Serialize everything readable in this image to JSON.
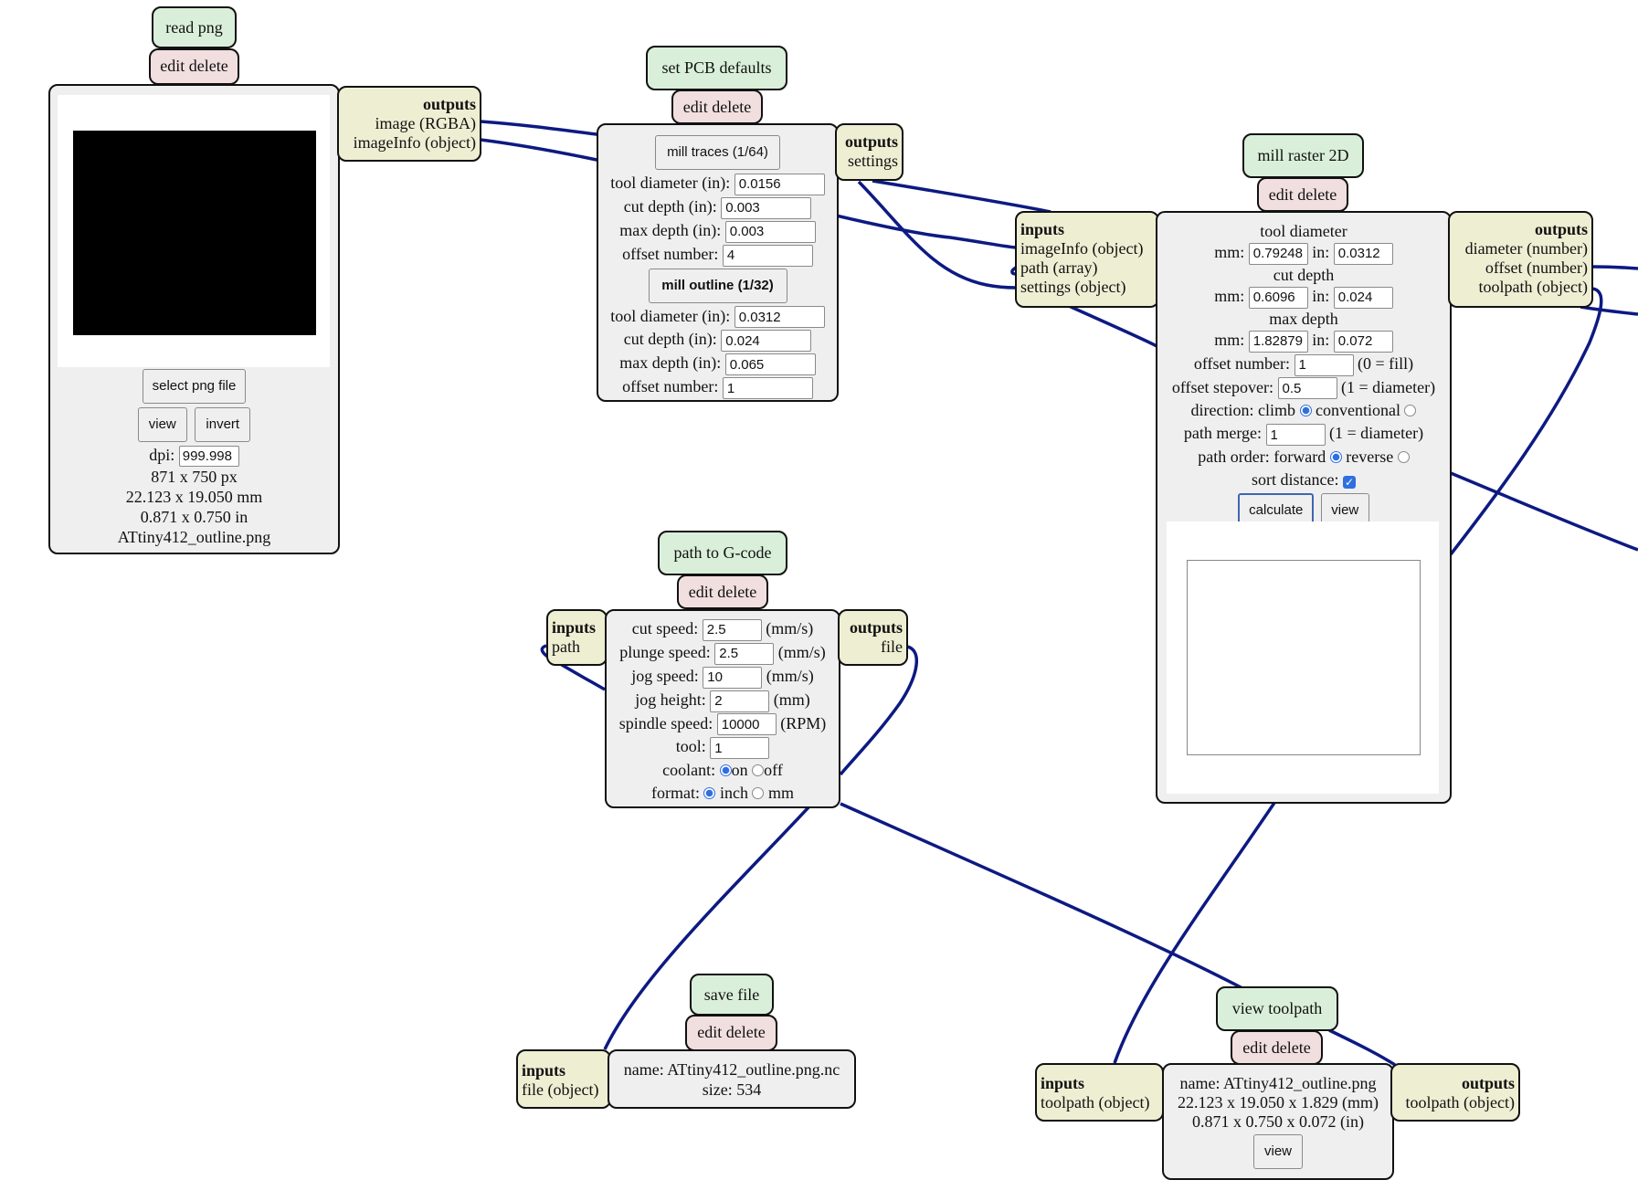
{
  "colors": {
    "wire": "#0d1a82",
    "title_bg": "#d9efd9",
    "edit_bg": "#f1dede",
    "io_bg": "#eeeed3",
    "body_bg": "#efefef",
    "radio_checked": "#2f6fe0"
  },
  "common": {
    "edit": "edit",
    "delete": "delete",
    "inputs": "inputs",
    "outputs": "outputs"
  },
  "modules": {
    "read_png": {
      "title": "read png",
      "outputs": [
        "image (RGBA)",
        "imageInfo (object)"
      ],
      "buttons": {
        "select": "select png file",
        "view": "view",
        "invert": "invert"
      },
      "dpi_label": "dpi:",
      "dpi_value": "999.998",
      "size_px": "871 x 750 px",
      "size_mm": "22.123 x 19.050 mm",
      "size_in": "0.871 x 0.750 in",
      "filename": "ATtiny412_outline.png"
    },
    "set_pcb_defaults": {
      "title": "set PCB defaults",
      "outputs": [
        "settings"
      ],
      "traces": {
        "button": "mill traces (1/64)",
        "tool_diameter_label": "tool diameter (in):",
        "tool_diameter": "0.0156",
        "cut_depth_label": "cut depth (in):",
        "cut_depth": "0.003",
        "max_depth_label": "max depth (in):",
        "max_depth": "0.003",
        "offset_number_label": "offset number:",
        "offset_number": "4"
      },
      "outline": {
        "button": "mill outline (1/32)",
        "tool_diameter_label": "tool diameter (in):",
        "tool_diameter": "0.0312",
        "cut_depth_label": "cut depth (in):",
        "cut_depth": "0.024",
        "max_depth_label": "max depth (in):",
        "max_depth": "0.065",
        "offset_number_label": "offset number:",
        "offset_number": "1"
      }
    },
    "mill_raster_2d": {
      "title": "mill raster 2D",
      "inputs": [
        "imageInfo (object)",
        "path (array)",
        "settings (object)"
      ],
      "outputs": [
        "diameter (number)",
        "offset (number)",
        "toolpath (object)"
      ],
      "tool_diameter_label": "tool diameter",
      "tool_diameter_mm": "0.79248",
      "tool_diameter_in": "0.0312",
      "cut_depth_label": "cut depth",
      "cut_depth_mm": "0.6096",
      "cut_depth_in": "0.024",
      "max_depth_label": "max depth",
      "max_depth_mm": "1.82879",
      "max_depth_in": "0.072",
      "mm_label": "mm:",
      "in_label": "in:",
      "offset_number_label": "offset number:",
      "offset_number": "1",
      "offset_number_hint": "(0 = fill)",
      "offset_stepover_label": "offset stepover:",
      "offset_stepover": "0.5",
      "offset_stepover_hint": "(1 = diameter)",
      "direction_label": "direction:",
      "direction_climb": "climb",
      "direction_conventional": "conventional",
      "direction_selected": "climb",
      "path_merge_label": "path merge:",
      "path_merge": "1",
      "path_merge_hint": "(1 = diameter)",
      "path_order_label": "path order:",
      "path_order_forward": "forward",
      "path_order_reverse": "reverse",
      "path_order_selected": "forward",
      "sort_distance_label": "sort distance:",
      "sort_distance": true,
      "calculate": "calculate",
      "view": "view"
    },
    "path_to_gcode": {
      "title": "path to G-code",
      "inputs": [
        "path"
      ],
      "outputs": [
        "file"
      ],
      "cut_speed_label": "cut speed:",
      "cut_speed": "2.5",
      "cut_speed_unit": "(mm/s)",
      "plunge_speed_label": "plunge speed:",
      "plunge_speed": "2.5",
      "plunge_speed_unit": "(mm/s)",
      "jog_speed_label": "jog speed:",
      "jog_speed": "10",
      "jog_speed_unit": "(mm/s)",
      "jog_height_label": "jog height:",
      "jog_height": "2",
      "jog_height_unit": "(mm)",
      "spindle_speed_label": "spindle speed:",
      "spindle_speed": "10000",
      "spindle_speed_unit": "(RPM)",
      "tool_label": "tool:",
      "tool": "1",
      "coolant_label": "coolant:",
      "coolant_on": "on",
      "coolant_off": "off",
      "coolant_selected": "on",
      "format_label": "format:",
      "format_inch": "inch",
      "format_mm": "mm",
      "format_selected": "inch"
    },
    "save_file": {
      "title": "save file",
      "inputs": [
        "file (object)"
      ],
      "name": "name: ATtiny412_outline.png.nc",
      "size": "size: 534"
    },
    "view_toolpath": {
      "title": "view toolpath",
      "inputs": [
        "toolpath (object)"
      ],
      "outputs": [
        "toolpath (object)"
      ],
      "name": "name: ATtiny412_outline.png",
      "dims_mm": "22.123 x 19.050 x 1.829 (mm)",
      "dims_in": "0.871 x 0.750 x 0.072 (in)",
      "view": "view"
    }
  }
}
